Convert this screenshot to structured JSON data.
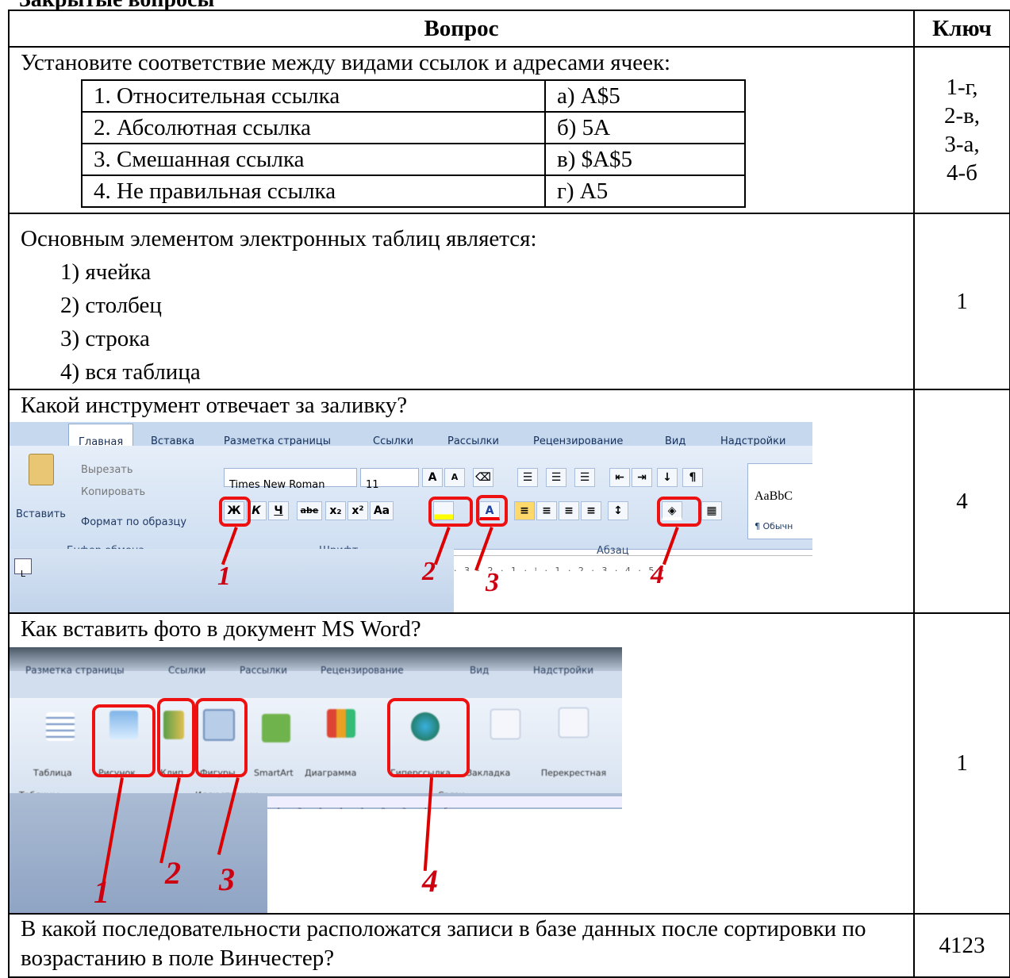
{
  "heading": "Закрытые вопросы",
  "table": {
    "col_question": "Вопрос",
    "col_key": "Ключ"
  },
  "q1": {
    "text": "Установите соответствие между видами ссылок и адресами ячеек:",
    "rows": [
      {
        "left": "1. Относительная ссылка",
        "right": "а) A$5"
      },
      {
        "left": "2. Абсолютная ссылка",
        "right": "б) 5A"
      },
      {
        "left": "3. Смешанная ссылка",
        "right": "в) $A$5"
      },
      {
        "left": "4. Не правильная ссылка",
        "right": "г) A5"
      }
    ],
    "key": [
      "1-г,",
      "2-в,",
      "3-а,",
      "4-б"
    ]
  },
  "q2": {
    "text": "Основным элементом электронных таблиц является:",
    "options": [
      "1) ячейка",
      "2) столбец",
      "3) строка",
      "4) вся таблица"
    ],
    "key": "1"
  },
  "q3": {
    "text": "Какой инструмент отвечает за заливку?",
    "key": "4",
    "ribbon": {
      "tabs": [
        "Главная",
        "Вставка",
        "Разметка страницы",
        "Ссылки",
        "Рассылки",
        "Рецензирование",
        "Вид",
        "Надстройки"
      ],
      "paste": "Вставить",
      "cut": "Вырезать",
      "copy": "Копировать",
      "format_painter": "Формат по образцу",
      "group_clipboard": "Буфер обмена",
      "group_font": "Шрифт",
      "group_paragraph": "Абзац",
      "font_name": "Times New Roman",
      "font_size": "11",
      "bold": "Ж",
      "italic": "К",
      "underline": "Ч",
      "strike": "abe",
      "sub": "x₂",
      "sup": "x²",
      "case": "Aa",
      "style_sample": "AaBbC",
      "style_name": "¶ Обычн",
      "numbers": [
        "1",
        "2",
        "3",
        "4"
      ]
    }
  },
  "q4": {
    "text": "Как вставить фото в документ MS Word?",
    "key": "1",
    "ribbon": {
      "tabs": [
        "Разметка страницы",
        "Ссылки",
        "Рассылки",
        "Рецензирование",
        "Вид",
        "Надстройки"
      ],
      "buttons": [
        "Таблица",
        "Рисунок",
        "Клип",
        "Фигуры",
        "SmartArt",
        "Диаграмма",
        "Гиперссылка",
        "Закладка",
        "Перекрестная ссылка"
      ],
      "groups": [
        "Таблицы",
        "Иллюстрации",
        "Связи"
      ],
      "numbers": [
        "1",
        "2",
        "3",
        "4"
      ]
    }
  },
  "q5": {
    "text": "В какой последовательности расположатся записи в базе данных после сортировки по возрастанию в поле Винчестер?",
    "key": "4123"
  }
}
